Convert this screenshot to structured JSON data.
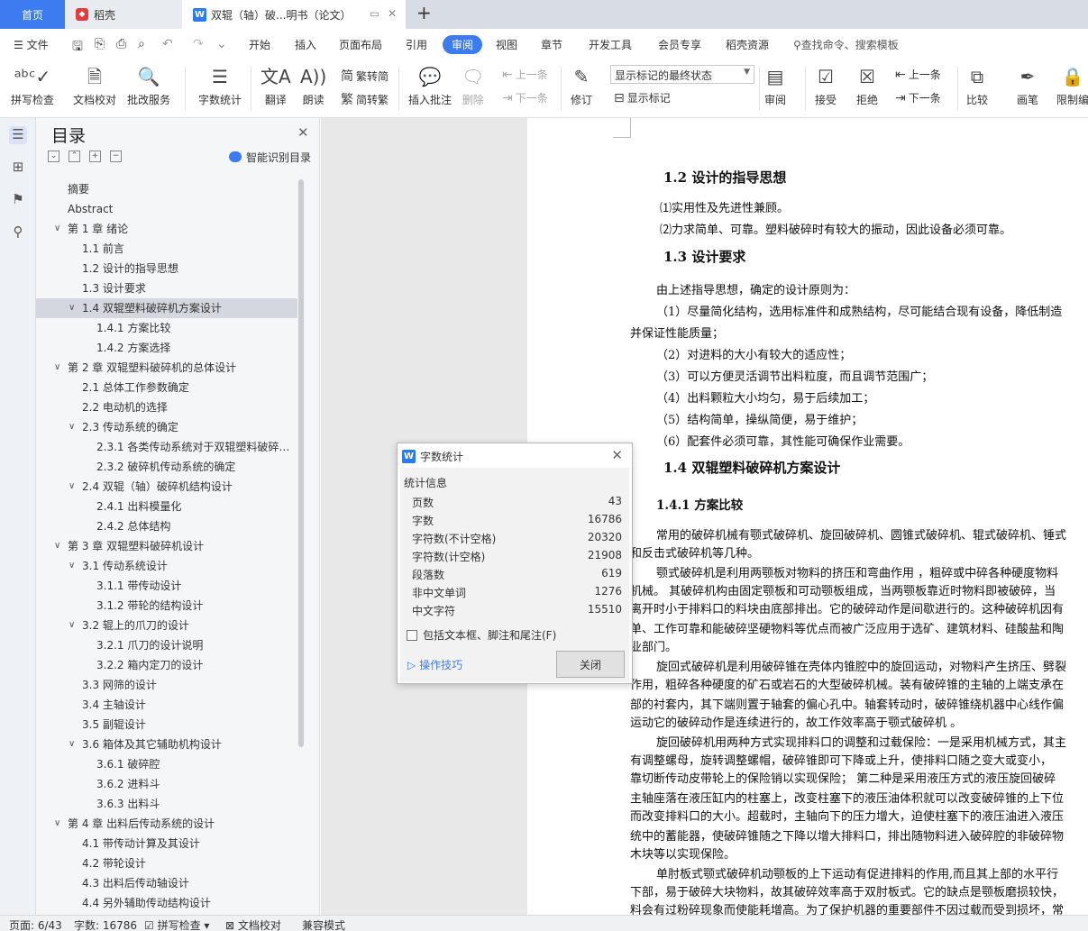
{
  "tabs": {
    "home": "首页",
    "shell": "稻壳",
    "doc": "双辊（轴）破...明书（论文）"
  },
  "menu": {
    "file": "文件",
    "items": [
      "开始",
      "插入",
      "页面布局",
      "引用",
      "审阅",
      "视图",
      "章节",
      "开发工具",
      "会员专享",
      "稻壳资源"
    ],
    "active": "审阅",
    "search": "查找命令、搜索模板"
  },
  "ribbon": {
    "spell": "拼写检查",
    "doccheck": "文档校对",
    "batch": "批改服务",
    "wordcount": "字数统计",
    "translate": "翻译",
    "read": "朗读",
    "trad": "繁转简",
    "simp": "简转繁",
    "insert_comment": "插入批注",
    "delete": "删除",
    "prev": "上一条",
    "next": "下一条",
    "track": "修订",
    "markup_select": "显示标记的最终状态",
    "show_markup": "显示标记",
    "review": "审阅",
    "accept": "接受",
    "reject": "拒绝",
    "prev2": "上一条",
    "next2": "下一条",
    "compare": "比较",
    "pen": "画笔",
    "restrict": "限制编"
  },
  "toc": {
    "title": "目录",
    "smart": "智能识别目录",
    "items": [
      {
        "text": "摘要",
        "level": 0,
        "arrow": false
      },
      {
        "text": "Abstract",
        "level": 0,
        "arrow": false
      },
      {
        "text": "第 1 章  绪论",
        "level": 0,
        "arrow": true
      },
      {
        "text": "1.1 前言",
        "level": 1,
        "arrow": false
      },
      {
        "text": "1.2 设计的指导思想",
        "level": 1,
        "arrow": false
      },
      {
        "text": "1.3  设计要求",
        "level": 1,
        "arrow": false
      },
      {
        "text": "1.4 双辊塑料破碎机方案设计",
        "level": 1,
        "arrow": true,
        "selected": true
      },
      {
        "text": "1.4.1 方案比较",
        "level": 2,
        "arrow": false
      },
      {
        "text": "1.4.2 方案选择",
        "level": 2,
        "arrow": false
      },
      {
        "text": "第 2 章  双辊塑料破碎机的总体设计",
        "level": 0,
        "arrow": true
      },
      {
        "text": "2.1 总体工作参数确定",
        "level": 1,
        "arrow": false
      },
      {
        "text": "2.2 电动机的选择",
        "level": 1,
        "arrow": false
      },
      {
        "text": "2.3 传动系统的确定",
        "level": 1,
        "arrow": true
      },
      {
        "text": "2.3.1 各类传动系统对于双辊塑料破碎 ...",
        "level": 2,
        "arrow": false
      },
      {
        "text": "2.3.2 破碎机传动系统的确定",
        "level": 2,
        "arrow": false
      },
      {
        "text": "2.4 双辊（轴）破碎机结构设计",
        "level": 1,
        "arrow": true
      },
      {
        "text": "2.4.1 出料模量化",
        "level": 2,
        "arrow": false
      },
      {
        "text": "2.4.2 总体结构",
        "level": 2,
        "arrow": false
      },
      {
        "text": "第 3 章  双辊塑料破碎机设计",
        "level": 0,
        "arrow": true
      },
      {
        "text": "3.1 传动系统设计",
        "level": 1,
        "arrow": true
      },
      {
        "text": "3.1.1 带传动设计",
        "level": 2,
        "arrow": false
      },
      {
        "text": "3.1.2 带轮的结构设计",
        "level": 2,
        "arrow": false
      },
      {
        "text": "3.2 辊上的爪刀的设计",
        "level": 1,
        "arrow": true
      },
      {
        "text": "3.2.1 爪刀的设计说明",
        "level": 2,
        "arrow": false
      },
      {
        "text": "3.2.2 箱内定刀的设计",
        "level": 2,
        "arrow": false
      },
      {
        "text": "3.3 网筛的设计",
        "level": 1,
        "arrow": false
      },
      {
        "text": "3.4 主轴设计",
        "level": 1,
        "arrow": false
      },
      {
        "text": "3.5 副辊设计",
        "level": 1,
        "arrow": false
      },
      {
        "text": "3.6 箱体及其它辅助机构设计",
        "level": 1,
        "arrow": true
      },
      {
        "text": "3.6.1  破碎腔",
        "level": 2,
        "arrow": false
      },
      {
        "text": "3.6.2  进料斗",
        "level": 2,
        "arrow": false
      },
      {
        "text": "3.6.3 出料斗",
        "level": 2,
        "arrow": false
      },
      {
        "text": "第 4 章  出料后传动系统的设计",
        "level": 0,
        "arrow": true
      },
      {
        "text": "4.1  带传动计算及其设计",
        "level": 1,
        "arrow": false
      },
      {
        "text": "4.2  带轮设计",
        "level": 1,
        "arrow": false
      },
      {
        "text": "4.3 出料后传动轴设计",
        "level": 1,
        "arrow": false
      },
      {
        "text": "4.4 另外辅助传动结构设计",
        "level": 1,
        "arrow": false
      }
    ]
  },
  "document": {
    "lines": [
      {
        "text": "1.2 设计的指导思想",
        "cls": "h2",
        "x": 0
      },
      {
        "text": "⑴实用性及先进性兼顾。",
        "cls": "",
        "x": 0
      },
      {
        "text": "⑵力求简单、可靠。塑料破碎时有较大的振动，因此设备必须可靠。",
        "cls": "",
        "x": 0
      },
      {
        "text": "1.3  设计要求",
        "cls": "h2",
        "x": 0
      },
      {
        "text": "由上述指导思想，确定的设计原则为：",
        "cls": "",
        "x": -4
      },
      {
        "text": "（1）尽量简化结构，选用标准件和成熟结构，尽可能结合现有设备，降低制造",
        "cls": "",
        "x": -4
      },
      {
        "text": "并保证性能质量；",
        "cls": "",
        "x": -33
      },
      {
        "text": "（2）对进料的大小有较大的适应性；",
        "cls": "",
        "x": -4
      },
      {
        "text": "（3）可以方便灵活调节出料粒度，而且调节范围广；",
        "cls": "",
        "x": -4
      },
      {
        "text": "（4）出料颗粒大小均匀，易于后续加工；",
        "cls": "",
        "x": -4
      },
      {
        "text": "（5）结构简单，操纵简便，易于维护；",
        "cls": "",
        "x": -4
      },
      {
        "text": "（6）配套件必须可靠，其性能可确保作业需要。",
        "cls": "",
        "x": -4
      },
      {
        "text": "1.4 双辊塑料破碎机方案设计",
        "cls": "h2",
        "x": 0
      },
      {
        "text": "1.4.1 方案比较",
        "cls": "h3",
        "x": -4
      },
      {
        "text": "常用的破碎机械有颚式破碎机、旋回破碎机、圆锥式破碎机、辊式破碎机、锤式",
        "cls": "",
        "x": -4
      },
      {
        "text": "和反击式破碎机等几种。",
        "cls": "",
        "x": -33
      },
      {
        "text": "颚式破碎机是利用两颚板对物料的挤压和弯曲作用 ，粗碎或中碎各种硬度物料",
        "cls": "",
        "x": -4
      },
      {
        "text": "机械。 其破碎机构由固定颚板和可动颚板组成，当两颚板靠近时物料即被破碎，当",
        "cls": "",
        "x": -33
      },
      {
        "text": "离开时小于排料口的料块由底部排出。它的破碎动作是间歇进行的。这种破碎机因有",
        "cls": "",
        "x": -33
      },
      {
        "text": "单、工作可靠和能破碎坚硬物料等优点而被广泛应用于选矿、建筑材料、硅酸盐和陶",
        "cls": "",
        "x": -33
      },
      {
        "text": "业部门。",
        "cls": "",
        "x": -33
      },
      {
        "text": "旋回式破碎机是利用破碎锥在壳体内锥腔中的旋回运动，对物料产生挤压、劈裂",
        "cls": "",
        "x": -4
      },
      {
        "text": "作用，粗碎各种硬度的矿石或岩石的大型破碎机械。装有破碎锥的主轴的上端支承在",
        "cls": "",
        "x": -33
      },
      {
        "text": "部的衬套内，其下端则置于轴套的偏心孔中。轴套转动时，破碎锥绕机器中心线作偏",
        "cls": "",
        "x": -33
      },
      {
        "text": "运动它的破碎动作是连续进行的，故工作效率高于颚式破碎机 。",
        "cls": "",
        "x": -33
      },
      {
        "text": "旋回破碎机用两种方式实现排料口的调整和过载保险：一是采用机械方式，其主",
        "cls": "",
        "x": -4
      },
      {
        "text": "有调整螺母，旋转调整螺帽，破碎锥即可下降或上升，使排料口随之变大或变小，",
        "cls": "",
        "x": -33
      },
      {
        "text": "靠切断传动皮带轮上的保险销以实现保险；  第二种是采用液压方式的液压旋回破碎",
        "cls": "",
        "x": -33
      },
      {
        "text": "主轴座落在液压缸内的柱塞上，改变柱塞下的液压油体积就可以改变破碎锥的上下位",
        "cls": "",
        "x": -33
      },
      {
        "text": "而改变排料口的大小。超载时，主轴向下的压力增大，迫使柱塞下的液压油进入液压",
        "cls": "",
        "x": -33
      },
      {
        "text": "统中的蓄能器，使破碎锥随之下降以增大排料口，排出随物料进入破碎腔的非破碎物",
        "cls": "",
        "x": -33
      },
      {
        "text": "木块等以实现保险。",
        "cls": "",
        "x": -33
      },
      {
        "text": "单肘板式颚式破碎机动颚板的上下运动有促进排料的作用,而且其上部的水平行",
        "cls": "",
        "x": -4
      },
      {
        "text": "下部，易于破碎大块物料，故其破碎效率高于双肘板式。它的缺点是颚板磨损较快，",
        "cls": "",
        "x": -33
      },
      {
        "text": "料会有过粉碎现象而使能耗增高。为了保护机器的重要部件不因过载而受到损坏，常",
        "cls": "",
        "x": -33
      }
    ]
  },
  "dialog": {
    "title": "字数统计",
    "section": "统计信息",
    "rows": [
      {
        "label": "页数",
        "value": "43"
      },
      {
        "label": "字数",
        "value": "16786"
      },
      {
        "label": "字符数(不计空格)",
        "value": "20320"
      },
      {
        "label": "字符数(计空格)",
        "value": "21908"
      },
      {
        "label": "段落数",
        "value": "619"
      },
      {
        "label": "非中文单词",
        "value": "1276"
      },
      {
        "label": "中文字符",
        "value": "15510"
      }
    ],
    "checkbox": "包括文本框、脚注和尾注(F)",
    "tips": "操作技巧",
    "close": "关闭"
  },
  "status": {
    "page": "页面: 6/43",
    "words": "字数: 16786",
    "spell": "拼写检查",
    "doccheck": "文档校对",
    "compat": "兼容模式"
  },
  "colors": {
    "accent": "#3d7cf0",
    "tabbar": "#d7dce5",
    "selected_toc": "#d4d8de"
  }
}
